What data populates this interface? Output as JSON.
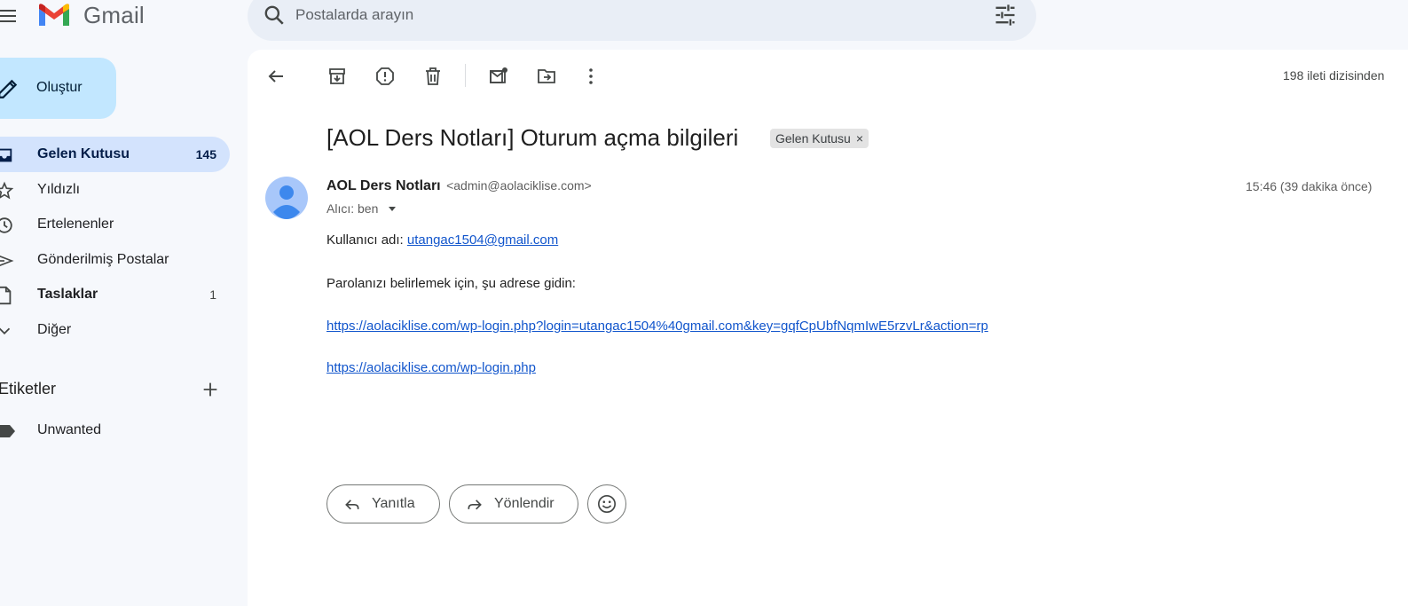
{
  "app": {
    "name": "Gmail"
  },
  "search": {
    "placeholder": "Postalarda arayın"
  },
  "sidebar": {
    "compose_label": "Oluştur",
    "items": [
      {
        "label": "Gelen Kutusu",
        "count": "145",
        "active": true,
        "icon": "inbox-icon"
      },
      {
        "label": "Yıldızlı",
        "count": "",
        "icon": "star-icon"
      },
      {
        "label": "Ertelenenler",
        "count": "",
        "icon": "clock-icon"
      },
      {
        "label": "Gönderilmiş Postalar",
        "count": "",
        "icon": "send-icon"
      },
      {
        "label": "Taslaklar",
        "count": "1",
        "icon": "draft-icon"
      },
      {
        "label": "Diğer",
        "count": "",
        "icon": "chevron-down-icon"
      }
    ],
    "labels_heading": "Etiketler",
    "labels": [
      {
        "label": "Unwanted",
        "icon": "label-icon"
      }
    ]
  },
  "toolbar": {
    "count_text": "198 ileti dizisinden"
  },
  "message": {
    "subject": "[AOL Ders Notları] Oturum açma bilgileri",
    "tag": "Gelen Kutusu",
    "tag_close": "×",
    "sender_name": "AOL Ders Notları",
    "sender_email": "<admin@aolaciklise.com>",
    "time": "15:46 (39 dakika önce)",
    "recipient": "Alıcı: ben",
    "body": {
      "username_label": "Kullanıcı adı:",
      "username_link": "utangac1504@gmail.com",
      "password_line": "Parolanızı belirlemek için, şu adrese gidin:",
      "reset_link": "https://aolaciklise.com/wp-login.php?login=utangac1504%40gmail.com&key=gqfCpUbfNqmIwE5rzvLr&action=rp",
      "login_link": "https://aolaciklise.com/wp-login.php"
    }
  },
  "actions": {
    "reply": "Yanıtla",
    "forward": "Yönlendir"
  },
  "colors": {
    "background": "#f6f8fc",
    "active_nav": "#d3e3fd",
    "compose": "#c2e7ff",
    "link": "#1155cc",
    "avatar": "#a8c7fa"
  }
}
